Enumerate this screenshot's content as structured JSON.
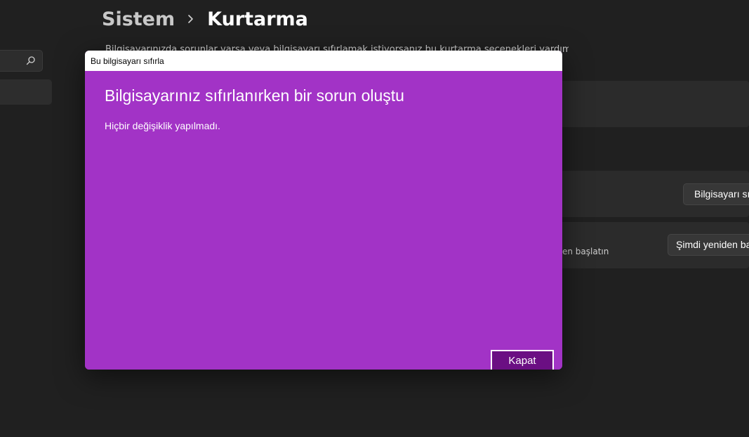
{
  "breadcrumb": {
    "parent": "Sistem",
    "current": "Kurtarma"
  },
  "page": {
    "description": "Bilgisayarınızda sorunlar varsa veya bilgisayarı sıfırlamak istiyorsanız bu kurtarma seçenekleri yardımcı olabilir"
  },
  "cards": {
    "reset_button_label": "Bilgisayarı sıfırla",
    "advanced_subtitle": "en başlatın",
    "restart_button_label": "Şimdi yeniden başlat"
  },
  "dialog": {
    "title": "Bu bilgisayarı sıfırla",
    "heading": "Bilgisayarınız sıfırlanırken bir sorun oluştu",
    "message": "Hiçbir değişiklik yapılmadı.",
    "close_label": "Kapat"
  },
  "colors": {
    "background": "#202020",
    "dialog_accent": "#a233c6",
    "button_accent": "#6b0f83"
  },
  "icons": {
    "search": "search-icon",
    "breadcrumb_separator": "chevron-right-icon"
  }
}
